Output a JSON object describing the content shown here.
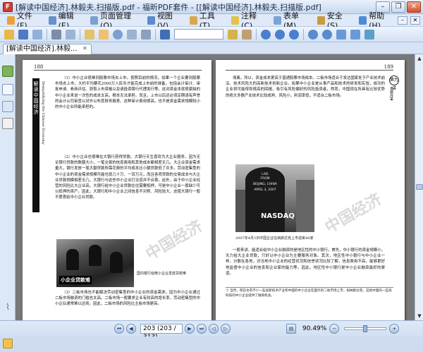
{
  "window": {
    "title": "[解读中国经济].林毅夫.扫描版.pdf - 福昕PDF套件 - [[解读中国经济].林毅夫.扫描版.pdf]",
    "app_icon": "foxit-pdf-icon",
    "controls": [
      "minimize-icon",
      "restore-icon",
      "close-icon"
    ]
  },
  "menu": {
    "items": [
      {
        "label": "文件(F)",
        "icon": "file-icon",
        "color": "#e8a23a"
      },
      {
        "label": "编辑(E)",
        "icon": "edit-icon",
        "color": "#6a8fc9"
      },
      {
        "label": "页面管理(O)",
        "icon": "pages-icon",
        "color": "#7aa0d2"
      },
      {
        "label": "视图(V)",
        "icon": "view-icon",
        "color": "#5a8ad0"
      },
      {
        "label": "工具(T)",
        "icon": "tools-icon",
        "color": "#d9a84b"
      },
      {
        "label": "注释(C)",
        "icon": "comment-icon",
        "color": "#e2c24a"
      },
      {
        "label": "表单(M)",
        "icon": "form-icon",
        "color": "#7ba4d6"
      },
      {
        "label": "安全(S)",
        "icon": "security-icon",
        "color": "#c89b3a"
      },
      {
        "label": "帮助(H)",
        "icon": "help-icon",
        "color": "#4d8bd6"
      }
    ]
  },
  "toolbar": {
    "buttons": [
      {
        "name": "open-icon",
        "color": "#e6b84a"
      },
      {
        "name": "save-icon",
        "color": "#4e79c4"
      },
      {
        "name": "email-icon",
        "color": "#8fb2dc"
      },
      {
        "name": "print-icon",
        "color": "#7c8da6"
      },
      {
        "name": "scan-icon",
        "color": "#9bb4d6"
      },
      {
        "name": "select-text-icon",
        "color": "#e1c36b"
      },
      {
        "name": "hand-icon",
        "color": "#f0c070"
      },
      {
        "name": "zoom-tool-icon",
        "color": "#7aa0d2"
      },
      {
        "name": "snapshot-icon",
        "color": "#9cb3cf"
      },
      {
        "name": "camera-icon",
        "color": "#8aa0c0"
      },
      {
        "name": "find-icon",
        "color": "#3f6fb5"
      },
      {
        "name": "highlight-icon",
        "color": "#d6b24c"
      },
      {
        "name": "typewriter-icon",
        "color": "#c0a070"
      },
      {
        "name": "first-page-icon",
        "color": "#4a7fd0"
      },
      {
        "name": "prev-page-icon",
        "color": "#4a7fd0"
      },
      {
        "name": "next-page-icon",
        "color": "#4a7fd0"
      },
      {
        "name": "zoom-in-icon",
        "color": "#5a8ad0"
      },
      {
        "name": "zoom-out-icon",
        "color": "#5a8ad0"
      },
      {
        "name": "actual-size-icon",
        "color": "#6a9ad6"
      },
      {
        "name": "fit-page-icon",
        "color": "#6a9ad6"
      },
      {
        "name": "rotate-icon",
        "color": "#5aa0c8"
      }
    ]
  },
  "tab": {
    "label": "[解读中国经济].林毅...",
    "close_icon": "close-icon"
  },
  "sidepanel": {
    "buttons": [
      "bookmarks-icon",
      "pages-thumb-icon",
      "layers-icon",
      "attachments-icon",
      "paperclip-icon"
    ]
  },
  "left_page": {
    "page_number": "188",
    "spine_cn": "解读中国经济",
    "spine_en": "Demystifying the Chinese Economy",
    "paragraphs": [
      "（1）中小企业很难到股票市场去上市。按照目前的情况，如果一个企业要到股票市场去上市，大约平均要花2000万人民币才能完成上市前的准备，包括会计审计、审批申请、券商评估、获取上市资格以及请投资银行代理发行等。这对资金本就很紧缺的中小企业来说一次性的成本太高，根本无法承担。而且，上市以后还必须定期请有声誉的会计公司审查以对外公布其财务报表，这种审计费用很高，也不是资金需求规模较小的中小企业所能承担的。",
      "（2）中小企业也很难在大银行获得贷款。大银行天生喜欢为大企业服务，因为无论银行贷款的数额大小，一笔交易的信息费用和其他成本都相差无几。大企业资金需求量大，银行发放一笔大额贷款所需花费的平均成本比小额贷款低了许多。劳动密集型的中小企业的资金需求规模可能也就几十万、一百万元，而且各项贷款的交易成本与大企业贷款规模相差无几，大银行与这些中小企业打交道并不合算。此外，由于中小企业经营的风险比大企业高，大银行给中小企业贷款往往需要抵押，可是中小企业一般缺少可以抵押的资产。因此，大银行和中小企业之间信息不对称、风险较大，这使大银行一般不愿意给中小企业贷款。"
    ],
    "photo_caption_overlay": "小企业贷款难",
    "photo_caption": "国内银行给微小企业发放贷款难",
    "paragraph_bottom": "（3）二板市场也不能解决劳动密集型的中小企业的资金需求。因为中小企业通过二板市场融资的门槛也太高。二板市场一般要求企业有较高的增长率，劳动密集型的中小企业通常难以达到。因此，二板市场的风险比主板市场更高。"
  },
  "right_page": {
    "page_number": "189",
    "chapter_circle": "第九讲",
    "chapter_text": "金融改革",
    "paragraph_top": "场离，所以，资金成本更高于普通股票市场成本。二板市场适合于发达国家处于产业技术前沿、技术风险大的高新技术创新企业。如果中小企业是从事产品和技术的研发和实验，成功的企业将可能得到很高的回报，吸引有风险偏好的风险投资者，然而，中国现在所具有比较优势的绝大多数产业技术比较成熟、风险小，利润率低，不适合二板市场。",
    "photo_text_lines": [
      "LIVE",
      "FROM",
      "BEIJING, CHINA",
      "APRIL 3, 2007"
    ],
    "photo_sign": "NASDAQ",
    "photo_caption": "2007年4月3日中国企业在纳斯达克上市迎来40家",
    "paragraph_bottom": "一般来讲，能适合给中小企业融资的是地区性的中小银行。首先，中小银行的资金规模小，无力给大企业贷款，只好以中小企业为主要服务对象。其次，地区性中小银行与中小企业一样，分散在各地，对当地中小企业的经营状况和信誉状况比较了解，信息费用不高，能够更好地监督中小企业的信息和企业家的能力等。因此，地区性中小银行是中小企业融资最好的渠道。",
    "footnote": "① 当然，现在也有不少一些高新技术产业和中国的中小企业在国外的二板市场上市，如纳斯达克，这给中国的一些高科技的中小企业提供了融资机会。"
  },
  "watermark": "中国经济",
  "status": {
    "page_display": "203 (203 / 313)",
    "zoom": "90.49%",
    "nav_icons": [
      "first-page-icon",
      "prev-page-icon",
      "next-page-icon",
      "last-page-icon",
      "back-icon",
      "forward-icon"
    ]
  }
}
